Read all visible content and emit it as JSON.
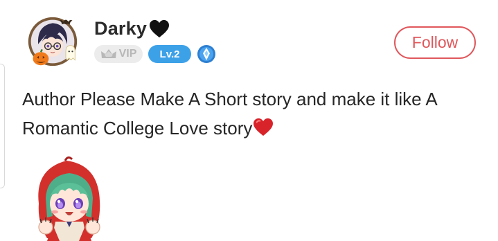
{
  "user": {
    "username": "Darky",
    "vip_label": "VIP",
    "level_label": "Lv.2"
  },
  "follow_button": {
    "label": "Follow"
  },
  "comment": {
    "text": "Author Please Make A Short story and make it like  A Romantic College Love story"
  },
  "icons": {
    "username_emoji": "black-heart-icon",
    "comment_emoji": "red-heart-icon",
    "vip": "crown-icon",
    "aura": "aura-diamond-icon"
  },
  "colors": {
    "follow_accent": "#e0575b",
    "level_badge": "#3da1e8",
    "vip_badge": "#ececec",
    "heart_red": "#d8232a"
  }
}
